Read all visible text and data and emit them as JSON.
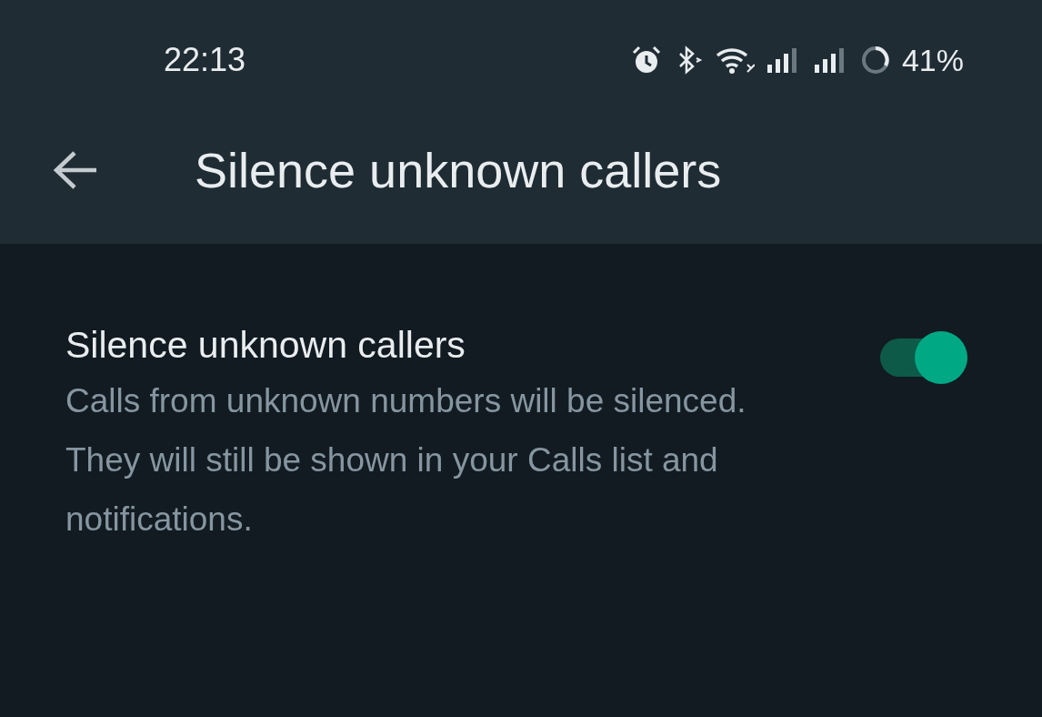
{
  "status_bar": {
    "time": "22:13",
    "battery": "41%"
  },
  "header": {
    "title": "Silence unknown callers"
  },
  "settings": [
    {
      "title": "Silence unknown callers",
      "description": "Calls from unknown numbers will be silenced. They will still be shown in your Calls list and notifications.",
      "on": true
    }
  ]
}
